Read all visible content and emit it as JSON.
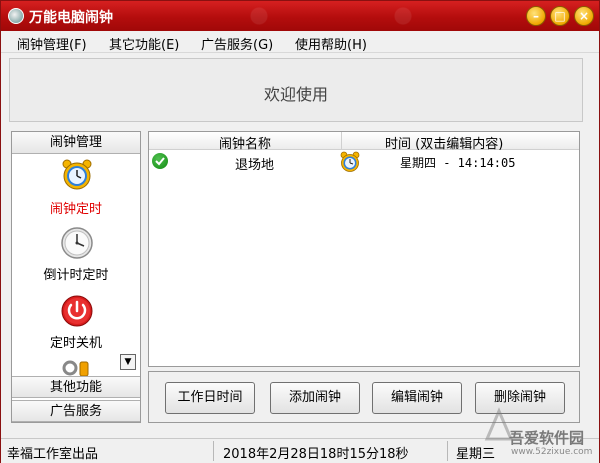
{
  "window": {
    "title": "万能电脑闹钟",
    "controls": {
      "minimize": "–",
      "maximize": "□",
      "close": "×"
    }
  },
  "menu": [
    "闹钟管理(F)",
    "其它功能(E)",
    "广告服务(G)",
    "使用帮助(H)"
  ],
  "banner": {
    "text": "欢迎使用"
  },
  "sidebar": {
    "header": "闹钟管理",
    "items": [
      {
        "label": "闹钟定时",
        "icon": "alarm-clock-icon",
        "active": true
      },
      {
        "label": "倒计时定时",
        "icon": "wall-clock-icon",
        "active": false
      },
      {
        "label": "定时关机",
        "icon": "power-icon",
        "active": false
      }
    ],
    "sections": [
      "其他功能",
      "广告服务"
    ]
  },
  "list": {
    "columns": [
      "闹钟名称",
      "时间 (双击编辑内容)"
    ],
    "rows": [
      {
        "status_icon": "check-icon",
        "name": "退场地",
        "type_icon": "alarm-clock-icon",
        "time": "星期四 - 14:14:05"
      }
    ]
  },
  "buttons": [
    "工作日时间",
    "添加闹钟",
    "编辑闹钟",
    "删除闹钟"
  ],
  "status": {
    "left": "幸福工作室出品",
    "datetime": "2018年2月28日18时15分18秒",
    "weekday": "星期三"
  },
  "watermark": {
    "text": "吾爱软件园",
    "url": "www.52zixue.com"
  },
  "colors": {
    "titlebar": "#c01010",
    "active_label": "#e00000"
  }
}
